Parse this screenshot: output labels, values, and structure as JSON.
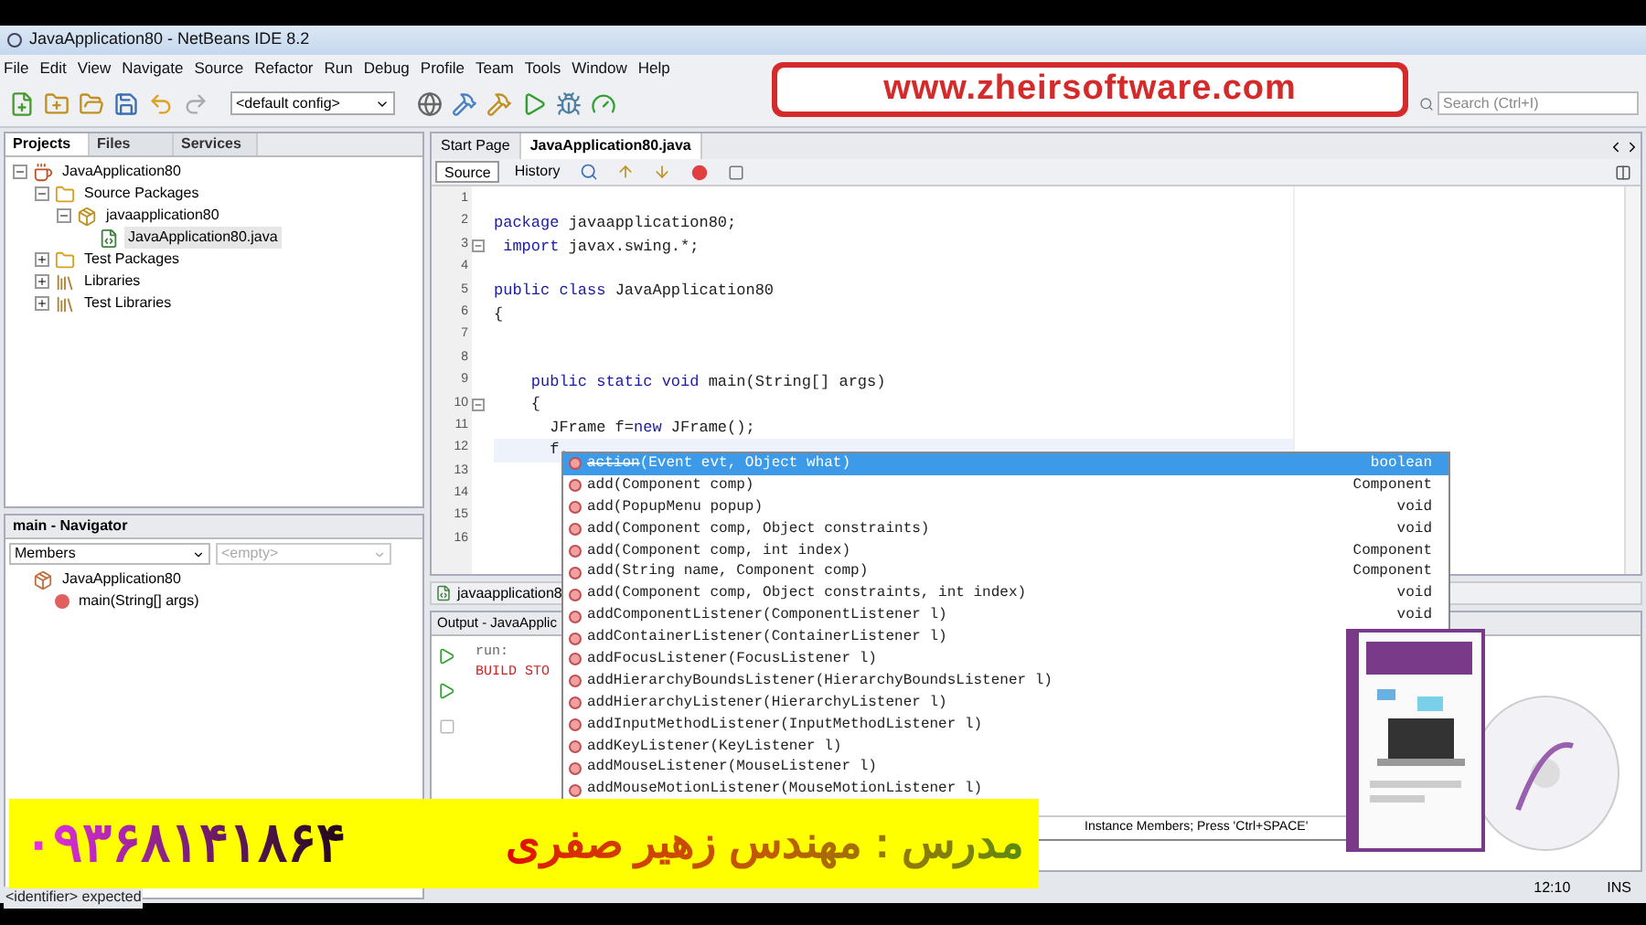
{
  "window": {
    "title": "JavaApplication80 - NetBeans IDE 8.2"
  },
  "menu": [
    "File",
    "Edit",
    "View",
    "Navigate",
    "Source",
    "Refactor",
    "Run",
    "Debug",
    "Profile",
    "Team",
    "Tools",
    "Window",
    "Help"
  ],
  "toolbar": {
    "config": "<default config>",
    "search": {
      "placeholder": "Search (Ctrl+I)"
    }
  },
  "banner": {
    "text": "www.zheirsoftware.com"
  },
  "projects": {
    "tabs": [
      {
        "label": "Projects",
        "selected": true
      },
      {
        "label": "Files",
        "selected": false
      },
      {
        "label": "Services",
        "selected": false
      }
    ],
    "tree": [
      {
        "label": "JavaApplication80",
        "kind": "project",
        "expanded": true,
        "children": [
          {
            "label": "Source Packages",
            "kind": "folder",
            "expanded": true,
            "children": [
              {
                "label": "javaapplication80",
                "kind": "package",
                "expanded": true,
                "children": [
                  {
                    "label": "JavaApplication80.java",
                    "kind": "file",
                    "selected": true
                  }
                ]
              }
            ]
          },
          {
            "label": "Test Packages",
            "kind": "folder",
            "expanded": false
          },
          {
            "label": "Libraries",
            "kind": "library",
            "expanded": false
          },
          {
            "label": "Test Libraries",
            "kind": "library",
            "expanded": false
          }
        ]
      }
    ]
  },
  "navigator": {
    "title": "main - Navigator",
    "filter": "Members",
    "scope": "<empty>",
    "tree": [
      {
        "label": "JavaApplication80",
        "kind": "class",
        "children": [
          {
            "label": "main(String[] args)",
            "kind": "method"
          }
        ]
      }
    ]
  },
  "editor": {
    "tabs": [
      {
        "label": "Start Page",
        "selected": false
      },
      {
        "label": "JavaApplication80.java",
        "selected": true
      }
    ],
    "views": [
      {
        "label": "Source",
        "selected": true
      },
      {
        "label": "History",
        "selected": false
      }
    ],
    "lines": [
      {
        "number": "1"
      },
      {
        "number": "2",
        "tokens": [
          {
            "text": "package",
            "kind": "keyword"
          },
          {
            "text": " javaapplication80;",
            "kind": "plain"
          }
        ]
      },
      {
        "number": "3",
        "fold": true,
        "tokens": [
          {
            "text": " import",
            "kind": "keyword"
          },
          {
            "text": " javax.swing.*;",
            "kind": "plain"
          }
        ]
      },
      {
        "number": "4"
      },
      {
        "number": "5",
        "tokens": [
          {
            "text": "public class",
            "kind": "keyword"
          },
          {
            "text": " JavaApplication80",
            "kind": "plain"
          }
        ]
      },
      {
        "number": "6",
        "tokens": [
          {
            "text": "{",
            "kind": "plain"
          }
        ]
      },
      {
        "number": "7"
      },
      {
        "number": "8"
      },
      {
        "number": "9",
        "tokens": [
          {
            "text": "    public static void",
            "kind": "keyword"
          },
          {
            "text": " main(String[] args)",
            "kind": "plain"
          }
        ]
      },
      {
        "number": "10",
        "fold": true,
        "tokens": [
          {
            "text": "    {",
            "kind": "plain"
          }
        ]
      },
      {
        "number": "11",
        "tokens": [
          {
            "text": "      JFrame f=",
            "kind": "plain"
          },
          {
            "text": "new",
            "kind": "keyword"
          },
          {
            "text": " JFrame();",
            "kind": "plain"
          }
        ]
      },
      {
        "number": "12",
        "current": true,
        "tokens": [
          {
            "text": "      f.",
            "kind": "plain"
          }
        ]
      },
      {
        "number": "13"
      },
      {
        "number": "14"
      },
      {
        "number": "15"
      },
      {
        "number": "16"
      }
    ],
    "breadcrumb": "javaapplication8"
  },
  "completion": {
    "items": [
      {
        "method": "action",
        "deprecated": true,
        "selected": true,
        "args": "(Event evt, Object what)",
        "returns": "boolean"
      },
      {
        "method": "add",
        "deprecated": false,
        "selected": false,
        "args": "(Component comp)",
        "returns": "Component"
      },
      {
        "method": "add",
        "deprecated": false,
        "selected": false,
        "args": "(PopupMenu popup)",
        "returns": "void"
      },
      {
        "method": "add",
        "deprecated": false,
        "selected": false,
        "args": "(Component comp, Object constraints)",
        "returns": "void"
      },
      {
        "method": "add",
        "deprecated": false,
        "selected": false,
        "args": "(Component comp, int index)",
        "returns": "Component"
      },
      {
        "method": "add",
        "deprecated": false,
        "selected": false,
        "args": "(String name, Component comp)",
        "returns": "Component"
      },
      {
        "method": "add",
        "deprecated": false,
        "selected": false,
        "args": "(Component comp, Object constraints, int index)",
        "returns": "void"
      },
      {
        "method": "addComponentListener",
        "deprecated": false,
        "selected": false,
        "args": "(ComponentListener l)",
        "returns": "void"
      },
      {
        "method": "addContainerListener",
        "deprecated": false,
        "selected": false,
        "args": "(ContainerListener l)"
      },
      {
        "method": "addFocusListener",
        "deprecated": false,
        "selected": false,
        "args": "(FocusListener l)"
      },
      {
        "method": "addHierarchyBoundsListener",
        "deprecated": false,
        "selected": false,
        "args": "(HierarchyBoundsListener l)"
      },
      {
        "method": "addHierarchyListener",
        "deprecated": false,
        "selected": false,
        "args": "(HierarchyListener l)"
      },
      {
        "method": "addInputMethodListener",
        "deprecated": false,
        "selected": false,
        "args": "(InputMethodListener l)"
      },
      {
        "method": "addKeyListener",
        "deprecated": false,
        "selected": false,
        "args": "(KeyListener l)"
      },
      {
        "method": "addMouseListener",
        "deprecated": false,
        "selected": false,
        "args": "(MouseListener l)"
      },
      {
        "method": "addMouseMotionListener",
        "deprecated": false,
        "selected": false,
        "args": "(MouseMotionListener l)"
      }
    ],
    "footer": "Instance Members; Press 'Ctrl+SPACE'"
  },
  "output": {
    "title": "Output - JavaApplic",
    "lines": [
      {
        "text": "run:",
        "kind": "info"
      },
      {
        "text": "BUILD STO",
        "kind": "error"
      }
    ]
  },
  "caption": {
    "phone": "۰۹۳۶۸۱۴۱۸۶۴",
    "teacher": "مدرس : مهندس زهیر صفری"
  },
  "status_bar": {
    "message": "<identifier> expected",
    "position": "12:10",
    "mode": "INS"
  }
}
